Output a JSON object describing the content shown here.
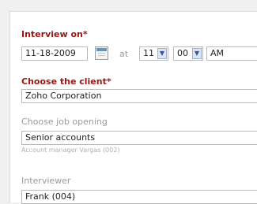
{
  "form": {
    "interview_on_label": "Interview on*",
    "date_value": "11-18-2009",
    "at_label": "at",
    "hour_value": "11",
    "minute_value": "00",
    "ampm_value": "AM",
    "client_label": "Choose the client*",
    "client_value": "Zoho Corporation",
    "job_label": "Choose job opening",
    "job_value": "Senior accounts",
    "job_subtext": "Account manager Vargas (002)",
    "interviewer_label": "Interviewer",
    "interviewer_value": "Frank (004)"
  },
  "colors": {
    "required_label": "#9a1515",
    "optional_label": "#9a9a9a",
    "select_arrow_bg": "#dde6f3",
    "select_arrow_fg": "#2e59a1"
  },
  "icons": {
    "calendar": "calendar-icon",
    "dropdown": "chevron-down-icon"
  }
}
